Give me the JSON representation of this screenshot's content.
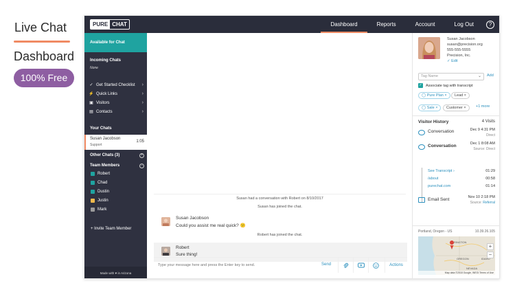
{
  "promo": {
    "title1": "Live Chat",
    "title2": "Dashboard",
    "badge": "100% Free"
  },
  "logo": {
    "part1": "PURE",
    "part2": "CHAT"
  },
  "nav": {
    "items": [
      "Dashboard",
      "Reports",
      "Account",
      "Log Out"
    ],
    "active": "Dashboard",
    "help": "?"
  },
  "sidebar": {
    "status": "Available for Chat",
    "incoming_title": "Incoming Chats",
    "incoming_empty": "None",
    "menu": [
      "Get Started Checklist",
      "Quick Links",
      "Visitors",
      "Contacts"
    ],
    "your_chats_title": "Your Chats",
    "active_chat": {
      "name": "Susan Jacobson",
      "sub": "Support",
      "time": "1:05"
    },
    "other_chats": "Other Chats (3)",
    "team_title": "Team Members",
    "members": [
      {
        "name": "Robert",
        "color": "#1fa3a0"
      },
      {
        "name": "Chad",
        "color": "#1fa3a0"
      },
      {
        "name": "Dustin",
        "color": "#1fa3a0"
      },
      {
        "name": "Justin",
        "color": "#f0b94c"
      },
      {
        "name": "Mark",
        "color": "#9a9a9a"
      }
    ],
    "invite": "+ Invite Team Member",
    "made_with": "Made with ♥ in Arizona"
  },
  "chat": {
    "system1": "Susan had a conversation with Robert on 8/10/2017",
    "system2": "Susan has joined the chat.",
    "msg1": {
      "name": "Susan Jacobson",
      "text": "Could you assist me real quick? 😕"
    },
    "system3": "Robert has joined the chat.",
    "msg2": {
      "name": "Robert",
      "text": "Sure thing!"
    },
    "composer_placeholder": "Type your message here and press the Enter key to send.",
    "send": "Send",
    "actions": "Actions"
  },
  "contact": {
    "name": "Susan Jacobson",
    "email": "susan@precision.org",
    "phone": "555-555-5555",
    "company": "Precision, Inc.",
    "edit": "✓ Edit",
    "tag_placeholder": "Tag Name",
    "tag_add": "Add",
    "associate": "Associate tag with transcript",
    "tags": [
      "Pure Plan",
      "Lead",
      "Sale",
      "Customer"
    ],
    "more_tags": "+1 more"
  },
  "history": {
    "title": "Visitor History",
    "count": "4 Visits",
    "row1": {
      "label": "Conversation",
      "date": "Dec 9 4:31 PM",
      "src": "Direct"
    },
    "row2": {
      "label": "Conversation",
      "date": "Dec 1 8:08 AM",
      "src_label": "Source:",
      "src": "Direct"
    },
    "links": [
      {
        "label": "See Transcript ›",
        "time": "01:29"
      },
      {
        "label": "/about",
        "time": "00:58"
      },
      {
        "label": "purechat.com",
        "time": "01:14"
      }
    ],
    "row3": {
      "label": "Email Sent",
      "date": "Nov 10 2:18 PM",
      "src_label": "Source:",
      "src": "Referral"
    }
  },
  "location": {
    "city": "Portland, Oregon - US",
    "ip": "10.39.26.105",
    "map_label1": "RINGTON",
    "map_label2": "OREGON",
    "map_label3": "IDAHO",
    "map_label4": "NEVADA",
    "zoom_in": "+",
    "zoom_out": "−",
    "footer": "Map data ©2018 Google, INEGI   Terms of Use"
  }
}
